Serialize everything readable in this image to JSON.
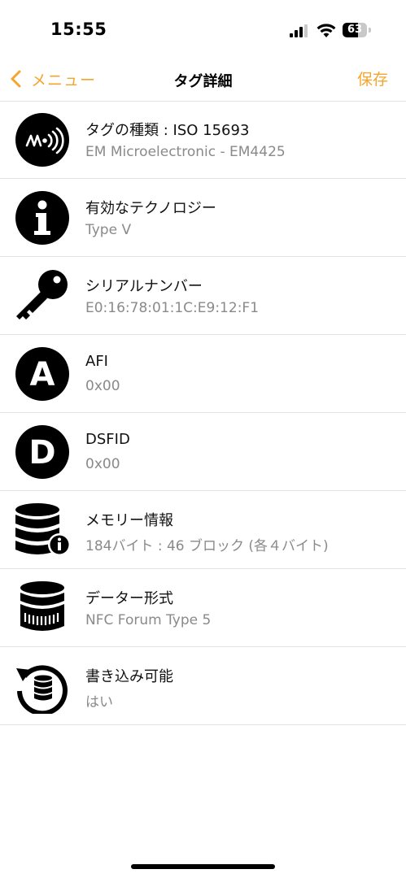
{
  "status_bar": {
    "time": "15:55",
    "battery_level": "63",
    "battery_fraction": 0.63
  },
  "nav": {
    "back_label": "メニュー",
    "title": "タグ詳細",
    "save_label": "保存"
  },
  "colors": {
    "accent": "#f4a52c",
    "secondary_text": "#8a8a8a",
    "separator": "#e4e4e4"
  },
  "rows": [
    {
      "icon": "nfc-tag-icon",
      "title": "タグの種類 : ISO 15693",
      "value": "EM Microelectronic - EM4425"
    },
    {
      "icon": "info-icon",
      "title": "有効なテクノロジー",
      "value": "Type V"
    },
    {
      "icon": "key-icon",
      "title": "シリアルナンバー",
      "value": "E0:16:78:01:1C:E9:12:F1"
    },
    {
      "icon": "letter-a-icon",
      "icon_letter": "A",
      "title": "AFI",
      "value": "0x00"
    },
    {
      "icon": "letter-d-icon",
      "icon_letter": "D",
      "title": "DSFID",
      "value": "0x00"
    },
    {
      "icon": "database-info-icon",
      "title": "メモリー情報",
      "value": "184バイト : 46 ブロック (各４バイト)"
    },
    {
      "icon": "database-format-icon",
      "title": "データー形式",
      "value": "NFC Forum Type 5"
    },
    {
      "icon": "database-rewrite-icon",
      "title": "書き込み可能",
      "value": "はい"
    }
  ]
}
